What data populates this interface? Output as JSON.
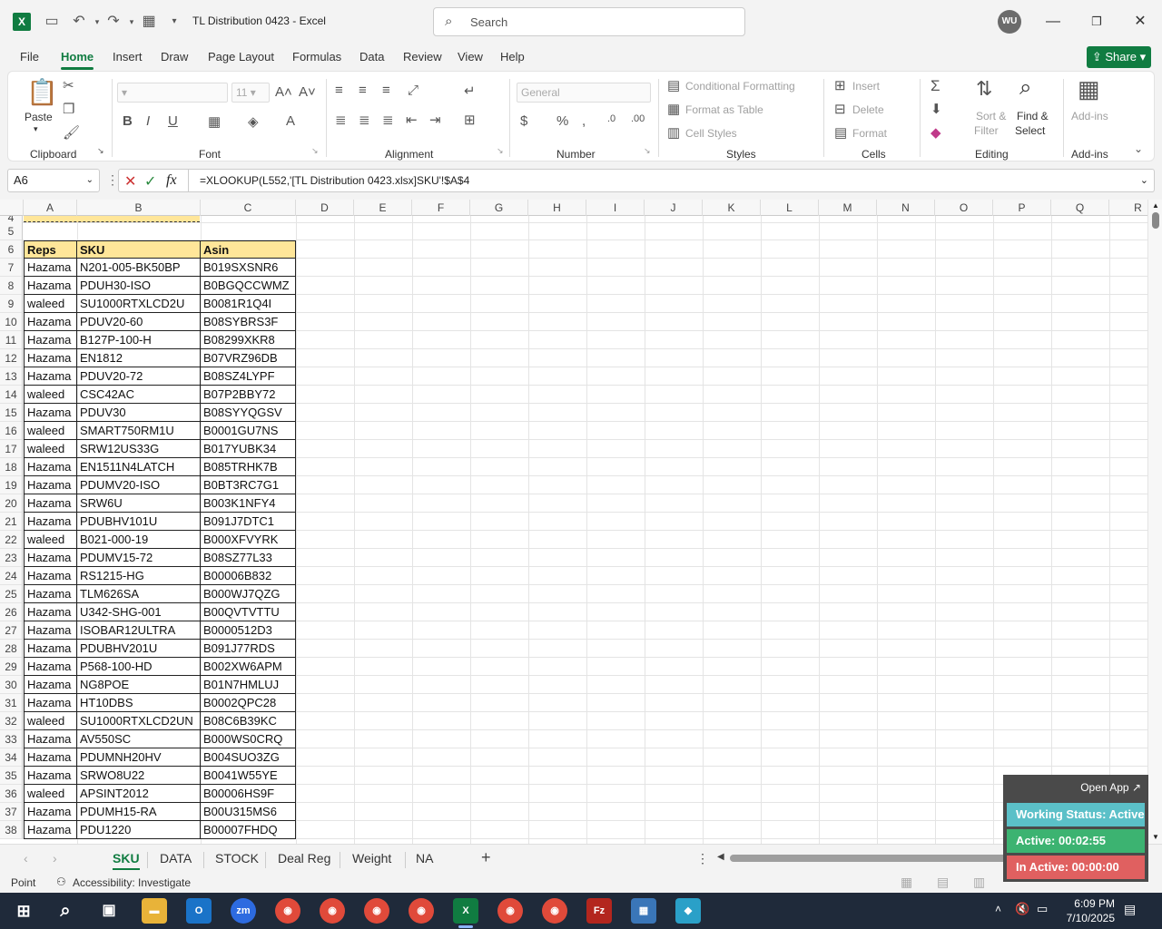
{
  "titlebar": {
    "doc_title": "TL Distribution 0423  -  Excel",
    "search_placeholder": "Search",
    "avatar": "WU"
  },
  "menu": {
    "items": [
      "File",
      "Home",
      "Insert",
      "Draw",
      "Page Layout",
      "Formulas",
      "Data",
      "Review",
      "View",
      "Help"
    ],
    "share": "Share"
  },
  "ribbon": {
    "clipboard": {
      "label": "Clipboard",
      "paste": "Paste"
    },
    "font": {
      "label": "Font",
      "size": "11"
    },
    "alignment": {
      "label": "Alignment"
    },
    "number": {
      "label": "Number",
      "format": "General"
    },
    "styles": {
      "label": "Styles",
      "conditional": "Conditional Formatting",
      "format_table": "Format as Table",
      "cell_styles": "Cell Styles"
    },
    "cells": {
      "label": "Cells",
      "insert": "Insert",
      "delete": "Delete",
      "format": "Format"
    },
    "editing": {
      "label": "Editing",
      "sort": "Sort &",
      "filter": "Filter",
      "find": "Find &",
      "select": "Select"
    },
    "addins": {
      "label": "Add-ins",
      "button": "Add-ins"
    }
  },
  "formula_bar": {
    "name_box": "A6",
    "formula": "=XLOOKUP(L552,'[TL Distribution 0423.xlsx]SKU'!$A$4"
  },
  "columns": [
    "A",
    "B",
    "C",
    "D",
    "E",
    "F",
    "G",
    "H",
    "I",
    "J",
    "K",
    "L",
    "M",
    "N",
    "O",
    "P",
    "Q",
    "R"
  ],
  "rows": [
    "4",
    "5",
    "6",
    "7",
    "8",
    "9",
    "10",
    "11",
    "12",
    "13",
    "14",
    "15",
    "16",
    "17",
    "18",
    "19",
    "20",
    "21",
    "22",
    "23",
    "24",
    "25",
    "26",
    "27",
    "28",
    "29",
    "30",
    "31",
    "32",
    "33",
    "34",
    "35",
    "36",
    "37",
    "38"
  ],
  "table": {
    "headers": [
      "Reps",
      "SKU",
      "Asin"
    ],
    "data": [
      [
        "Hazama",
        "N201-005-BK50BP",
        "B019SXSNR6"
      ],
      [
        "Hazama",
        "PDUH30-ISO",
        "B0BGQCCWMZ"
      ],
      [
        "waleed",
        "SU1000RTXLCD2U",
        "B0081R1Q4I"
      ],
      [
        "Hazama",
        "PDUV20-60",
        "B08SYBRS3F"
      ],
      [
        "Hazama",
        "B127P-100-H",
        "B08299XKR8"
      ],
      [
        "Hazama",
        "EN1812",
        "B07VRZ96DB"
      ],
      [
        "Hazama",
        "PDUV20-72",
        "B08SZ4LYPF"
      ],
      [
        "waleed",
        "CSC42AC",
        "B07P2BBY72"
      ],
      [
        "Hazama",
        "PDUV30",
        "B08SYYQGSV"
      ],
      [
        "waleed",
        "SMART750RM1U",
        "B0001GU7NS"
      ],
      [
        "waleed",
        "SRW12US33G",
        "B017YUBK34"
      ],
      [
        "Hazama",
        "EN1511N4LATCH",
        "B085TRHK7B"
      ],
      [
        "Hazama",
        "PDUMV20-ISO",
        "B0BT3RC7G1"
      ],
      [
        "Hazama",
        "SRW6U",
        "B003K1NFY4"
      ],
      [
        "Hazama",
        "PDUBHV101U",
        "B091J7DTC1"
      ],
      [
        "waleed",
        "B021-000-19",
        "B000XFVYRK"
      ],
      [
        "Hazama",
        "PDUMV15-72",
        "B08SZ77L33"
      ],
      [
        "Hazama",
        "RS1215-HG",
        "B00006B832"
      ],
      [
        "Hazama",
        "TLM626SA",
        "B000WJ7QZG"
      ],
      [
        "Hazama",
        "U342-SHG-001",
        "B00QVTVTTU"
      ],
      [
        "Hazama",
        "ISOBAR12ULTRA",
        "B0000512D3"
      ],
      [
        "Hazama",
        "PDUBHV201U",
        "B091J77RDS"
      ],
      [
        "Hazama",
        "P568-100-HD",
        "B002XW6APM"
      ],
      [
        "Hazama",
        "NG8POE",
        "B01N7HMLUJ"
      ],
      [
        "Hazama",
        "HT10DBS",
        "B0002QPC28"
      ],
      [
        "waleed",
        "SU1000RTXLCD2UN",
        "B08C6B39KC"
      ],
      [
        "Hazama",
        "AV550SC",
        "B000WS0CRQ"
      ],
      [
        "Hazama",
        "PDUMNH20HV",
        "B004SUO3ZG"
      ],
      [
        "Hazama",
        "SRWO8U22",
        "B0041W55YE"
      ],
      [
        "waleed",
        "APSINT2012",
        "B00006HS9F"
      ],
      [
        "Hazama",
        "PDUMH15-RA",
        "B00U315MS6"
      ],
      [
        "Hazama",
        "PDU1220",
        "B00007FHDQ"
      ]
    ]
  },
  "sheet_tabs": [
    "SKU",
    "DATA",
    "STOCK",
    "Deal Reg",
    "Weight",
    "NA"
  ],
  "statusbar": {
    "mode": "Point",
    "accessibility": "Accessibility: Investigate"
  },
  "widget": {
    "open_app": "Open App",
    "working_status": "Working Status: Active",
    "active": "Active: 00:02:55",
    "inactive": "In Active: 00:00:00",
    "colors": {
      "status": "#5bc0c8",
      "active": "#3cb371",
      "inactive": "#e06060"
    }
  },
  "taskbar": {
    "time": "6:09 PM",
    "date": "7/10/2025"
  },
  "colors": {
    "accent": "#107c41",
    "header_fill": "#ffe699"
  }
}
